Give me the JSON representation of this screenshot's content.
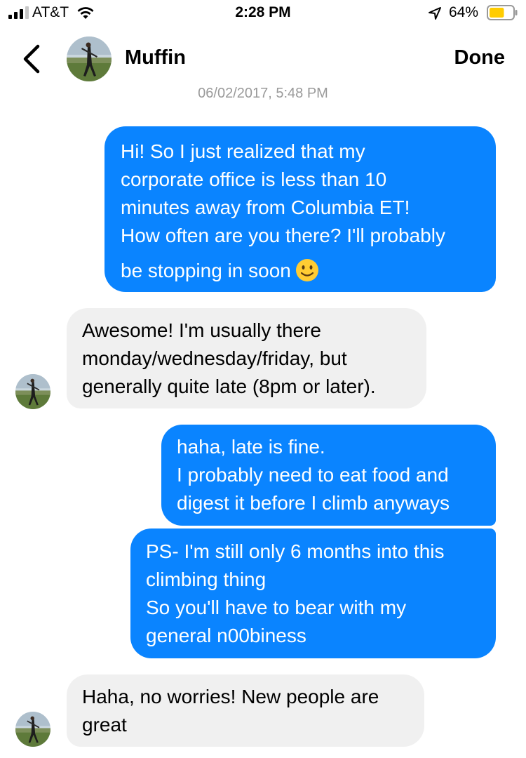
{
  "status_bar": {
    "carrier": "AT&T",
    "time": "2:28 PM",
    "battery_percent": "64%",
    "battery_level": 0.64,
    "icons": [
      "signal-icon",
      "wifi-icon",
      "location-arrow-icon",
      "battery-icon"
    ]
  },
  "header": {
    "back_icon": "chevron-left-icon",
    "contact_name": "Muffin",
    "done_label": "Done"
  },
  "conversation": {
    "timestamp": "06/02/2017, 5:48 PM",
    "messages": [
      {
        "direction": "outgoing",
        "lines": [
          "Hi! So I just realized that my",
          "corporate office is less than  10",
          "minutes away from Columbia ET!",
          "How often are you there? I'll probably",
          "be stopping in soon"
        ],
        "emoji": "slightly-smiling-face"
      },
      {
        "direction": "incoming",
        "lines": [
          "Awesome! I'm usually there",
          "monday/wednesday/friday, but",
          "generally quite late (8pm or later)."
        ]
      },
      {
        "direction": "outgoing",
        "lines": [
          "haha, late is fine.",
          "I probably need to eat food and",
          "digest it before I climb anyways"
        ]
      },
      {
        "direction": "outgoing",
        "lines": [
          "PS- I'm still only 6 months into this",
          "climbing thing",
          "So you'll have to bear with my",
          "general n00biness"
        ]
      },
      {
        "direction": "incoming",
        "lines": [
          "Haha, no worries! New people are",
          "great"
        ]
      }
    ]
  },
  "colors": {
    "outgoing_bubble": "#0a84ff",
    "incoming_bubble": "#f0f0f0",
    "timestamp": "#9a9a9a",
    "battery_fill": "#ffcc00"
  }
}
